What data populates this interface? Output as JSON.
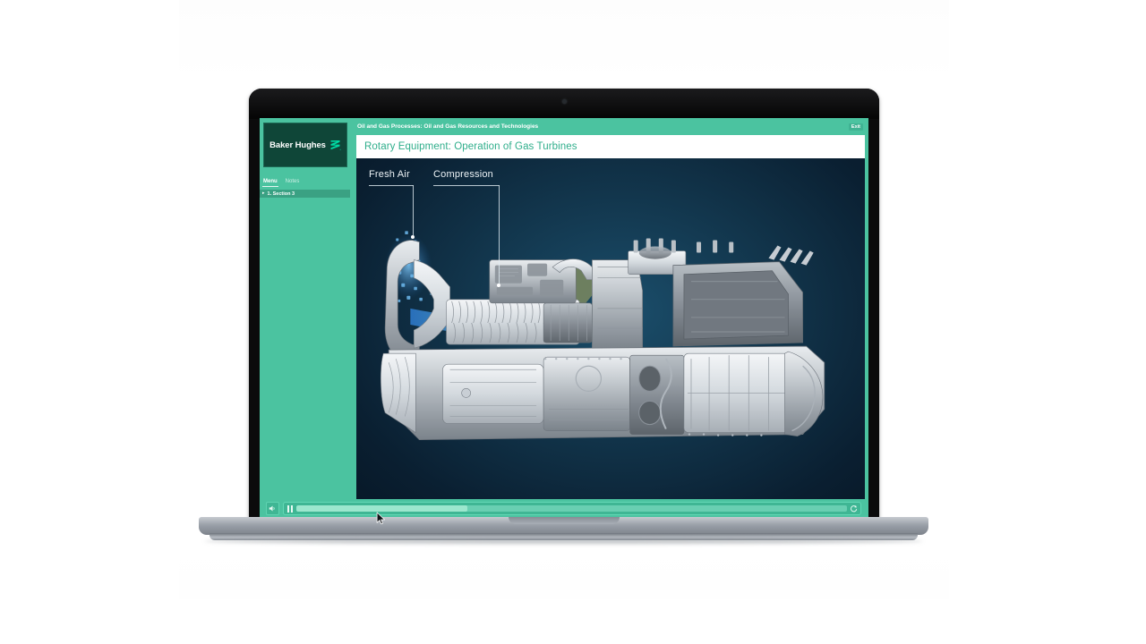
{
  "app": {
    "brand": {
      "name": "Baker Hughes",
      "mark": "baker-hughes-swoosh"
    },
    "course_title": "Oil and Gas Processes: Oil and Gas Resources and Technologies",
    "exit_label": "Exit",
    "sidebar": {
      "tabs": [
        {
          "label": "Menu",
          "active": true
        },
        {
          "label": "Notes",
          "active": false
        }
      ],
      "toc": [
        {
          "arrow": "▸",
          "label": "1. Section 3",
          "selected": true
        }
      ]
    },
    "slide": {
      "title": "Rotary Equipment: Operation of Gas Turbines",
      "annotations": [
        {
          "label": "Fresh Air"
        },
        {
          "label": "Compression"
        }
      ],
      "illustration": "gas-turbine-cutaway"
    },
    "player": {
      "volume_icon": "speaker-icon",
      "play_state_icon": "pause-icon",
      "replay_icon": "replay-icon",
      "progress_percent": 31
    }
  },
  "colors": {
    "brand_green": "#4BC3A0",
    "brand_dark_green": "#0f4638",
    "title_text_green": "#2fae8b",
    "slide_background": "#0c2236",
    "progress_fill": "#9ce7ce",
    "page_background": "#ffffff"
  },
  "device": {
    "type": "laptop",
    "camera": "webcam-dot"
  }
}
